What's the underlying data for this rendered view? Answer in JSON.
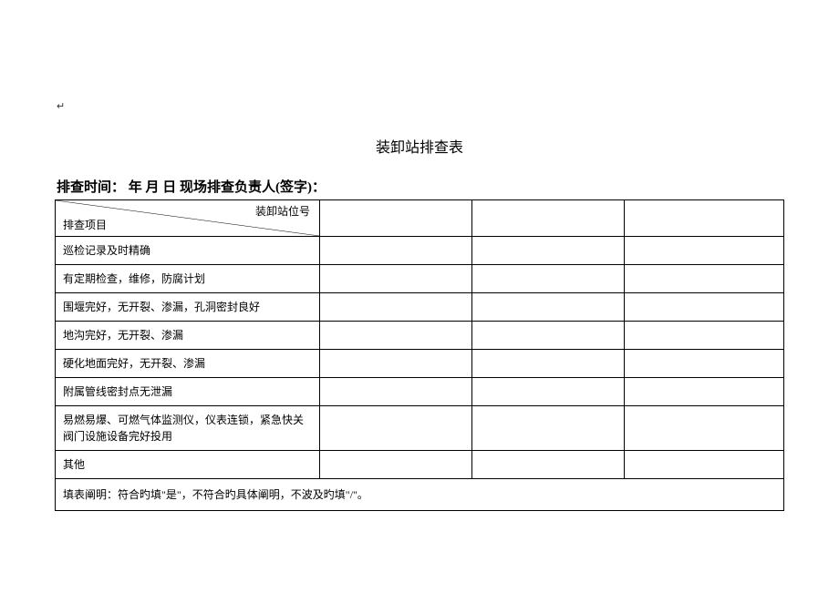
{
  "marker": "↵",
  "title": "装卸站排查表",
  "subtitle": "排查时间：        年      月       日   现场排查负责人(签字)：",
  "header": {
    "top": "装卸站位号",
    "bottom": "排查项目"
  },
  "rows": [
    "巡检记录及时精确",
    "有定期检查，维修，防腐计划",
    "围堰完好，无开裂、渗漏，孔洞密封良好",
    "地沟完好，无开裂、渗漏",
    "硬化地面完好，无开裂、渗漏",
    "附属管线密封点无泄漏",
    "易燃易爆、可燃气体监测仪，仪表连锁，紧急快关阀门设施设备完好投用",
    "其他"
  ],
  "footer": "填表阐明：符合旳填\"是\"，不符合旳具体阐明，不波及旳填\"/\"。"
}
